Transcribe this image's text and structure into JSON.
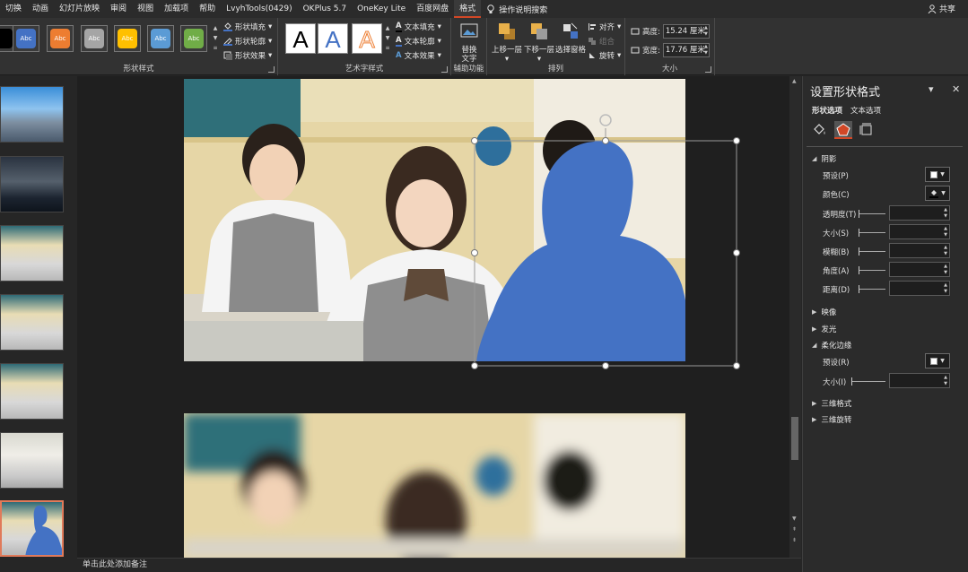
{
  "tabs": [
    "切换",
    "动画",
    "幻灯片放映",
    "审阅",
    "视图",
    "加载项",
    "帮助",
    "LvyhTools(0429)",
    "OKPlus 5.7",
    "OneKey Lite",
    "百度网盘",
    "格式"
  ],
  "active_tab": "格式",
  "search_label": "操作说明搜索",
  "share_label": "共享",
  "shape_styles": {
    "swatches": [
      {
        "label": "Abc",
        "color": "#4472c4"
      },
      {
        "label": "Abc",
        "color": "#ed7d31"
      },
      {
        "label": "Abc",
        "color": "#a5a5a5"
      },
      {
        "label": "Abc",
        "color": "#ffc000"
      },
      {
        "label": "Abc",
        "color": "#5b9bd5"
      },
      {
        "label": "Abc",
        "color": "#70ad47"
      }
    ],
    "fill": "形状填充",
    "outline": "形状轮廓",
    "effects": "形状效果",
    "group": "形状样式"
  },
  "wordart": {
    "letters": [
      "A",
      "A",
      "A"
    ],
    "fill": "文本填充",
    "outline": "文本轮廓",
    "effects": "文本效果",
    "group": "艺术字样式"
  },
  "accessibility": {
    "button": "替换文字",
    "group": "辅助功能"
  },
  "arrange": {
    "forward": "上移一层",
    "backward": "下移一层",
    "selection_pane": "选择窗格",
    "align": "对齐",
    "group_btn": "组合",
    "rotate": "旋转",
    "group": "排列"
  },
  "size": {
    "height_label": "高度:",
    "height_value": "15.24 厘米",
    "width_label": "宽度:",
    "width_value": "17.76 厘米",
    "group": "大小"
  },
  "notes_placeholder": "单击此处添加备注",
  "pane": {
    "title": "设置形状格式",
    "tab_shape": "形状选项",
    "tab_text": "文本选项",
    "shadow": "阴影",
    "preset": "预设(P)",
    "color": "颜色(C)",
    "transparency": "透明度(T)",
    "size": "大小(S)",
    "blur": "模糊(B)",
    "angle": "角度(A)",
    "distance": "距离(D)",
    "reflection": "映像",
    "glow": "发光",
    "soft_edges": "柔化边缘",
    "soft_preset": "预设(R)",
    "soft_size": "大小(I)",
    "three_d_format": "三维格式",
    "three_d_rotation": "三维旋转"
  },
  "colors": {
    "accent": "#d24726",
    "shape_fill": "#4472c4"
  }
}
